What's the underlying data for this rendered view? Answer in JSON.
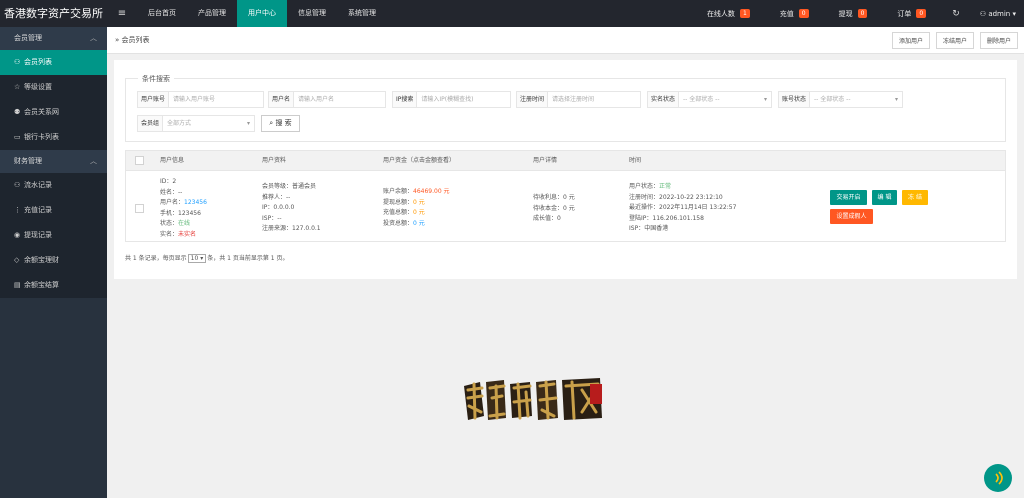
{
  "app": {
    "title": "香港数字资产交易所",
    "menu_icon": "≡"
  },
  "topnav": [
    {
      "label": "后台首页"
    },
    {
      "label": "产品管理"
    },
    {
      "label": "用户中心"
    },
    {
      "label": "信息管理"
    },
    {
      "label": "系统管理"
    }
  ],
  "stats": [
    {
      "label": "在线人数",
      "count": "1"
    },
    {
      "label": "充值",
      "count": "0"
    },
    {
      "label": "提现",
      "count": "0"
    },
    {
      "label": "订单",
      "count": "0"
    }
  ],
  "user": {
    "name": "admin"
  },
  "sidebar": {
    "group1": "会员管理",
    "items1": [
      {
        "label": "会员列表",
        "icon": "user-icon"
      },
      {
        "label": "等级设置",
        "icon": "star-icon"
      },
      {
        "label": "会员关系网",
        "icon": "users-icon"
      },
      {
        "label": "银行卡列表",
        "icon": "card-icon"
      }
    ],
    "group2": "财务管理",
    "items2": [
      {
        "label": "流水记录",
        "icon": "user-icon"
      },
      {
        "label": "充值记录",
        "icon": "dots-icon"
      },
      {
        "label": "提现记录",
        "icon": "circle-icon"
      },
      {
        "label": "余额宝理财",
        "icon": "diamond-icon"
      },
      {
        "label": "余额宝结算",
        "icon": "list-icon"
      }
    ]
  },
  "tabbar": {
    "crumb": "会员列表",
    "actions": [
      "添加用户",
      "冻结用户",
      "删除用户"
    ]
  },
  "search": {
    "legend": "条件搜索",
    "fields": [
      {
        "label": "用户账号",
        "placeholder": "请输入用户账号"
      },
      {
        "label": "用户名",
        "placeholder": "请输入用户名"
      },
      {
        "label": "IP搜索",
        "placeholder": "请输入IP(模糊查找)"
      },
      {
        "label": "注册时间",
        "placeholder": "请选择注册时间"
      },
      {
        "label": "实名状态",
        "placeholder": "-- 全部状态 --"
      },
      {
        "label": "账号状态",
        "placeholder": "-- 全部状态 --"
      },
      {
        "label": "会员组",
        "placeholder": "全部方式"
      }
    ],
    "button": "搜 索"
  },
  "table": {
    "headers": [
      "用户信息",
      "用户资料",
      "用户资金（点击金额查看）",
      "用户详情",
      "时间"
    ],
    "row": {
      "info": [
        "ID：2",
        "姓名：--",
        "用户名：",
        "手机：123456",
        "状态：",
        "实名："
      ],
      "username": "123456",
      "status": "在线",
      "realname": "未实名",
      "profile": [
        "会员等级：普通会员",
        "推荐人：--",
        "IP：0.0.0.0",
        "ISP：--",
        "注册来源：127.0.0.1"
      ],
      "funds_labels": [
        "账户余额：",
        "提现总额：",
        "充值总额：",
        "投资总额："
      ],
      "funds_values": [
        "46469.00 元",
        "0 元",
        "0 元",
        "0 元"
      ],
      "details": [
        "待收利息：0 元",
        "待收本金：0 元",
        "成长值：0"
      ],
      "time_status_label": "用户状态：",
      "time_status": "正常",
      "times": [
        "注册时间：2022-10-22 23:12:10",
        "最近操作：2022年11月14日 13:22:57",
        "登陆IP：116.206.101.158",
        "ISP：中国香港"
      ],
      "buttons": [
        "交易开启",
        "编 辑",
        "冻 结",
        "设置成假人"
      ]
    }
  },
  "pager": {
    "text_before": "共 1 条记录，每页显示",
    "page_size": "10",
    "text_after": "条，共 1 页当前显示第 1 页。"
  },
  "colors": {
    "accent": "#009688",
    "topbar": "#23262e",
    "sidebar": "#28323e",
    "badge": "#ff5722",
    "warn": "#ffb800"
  }
}
